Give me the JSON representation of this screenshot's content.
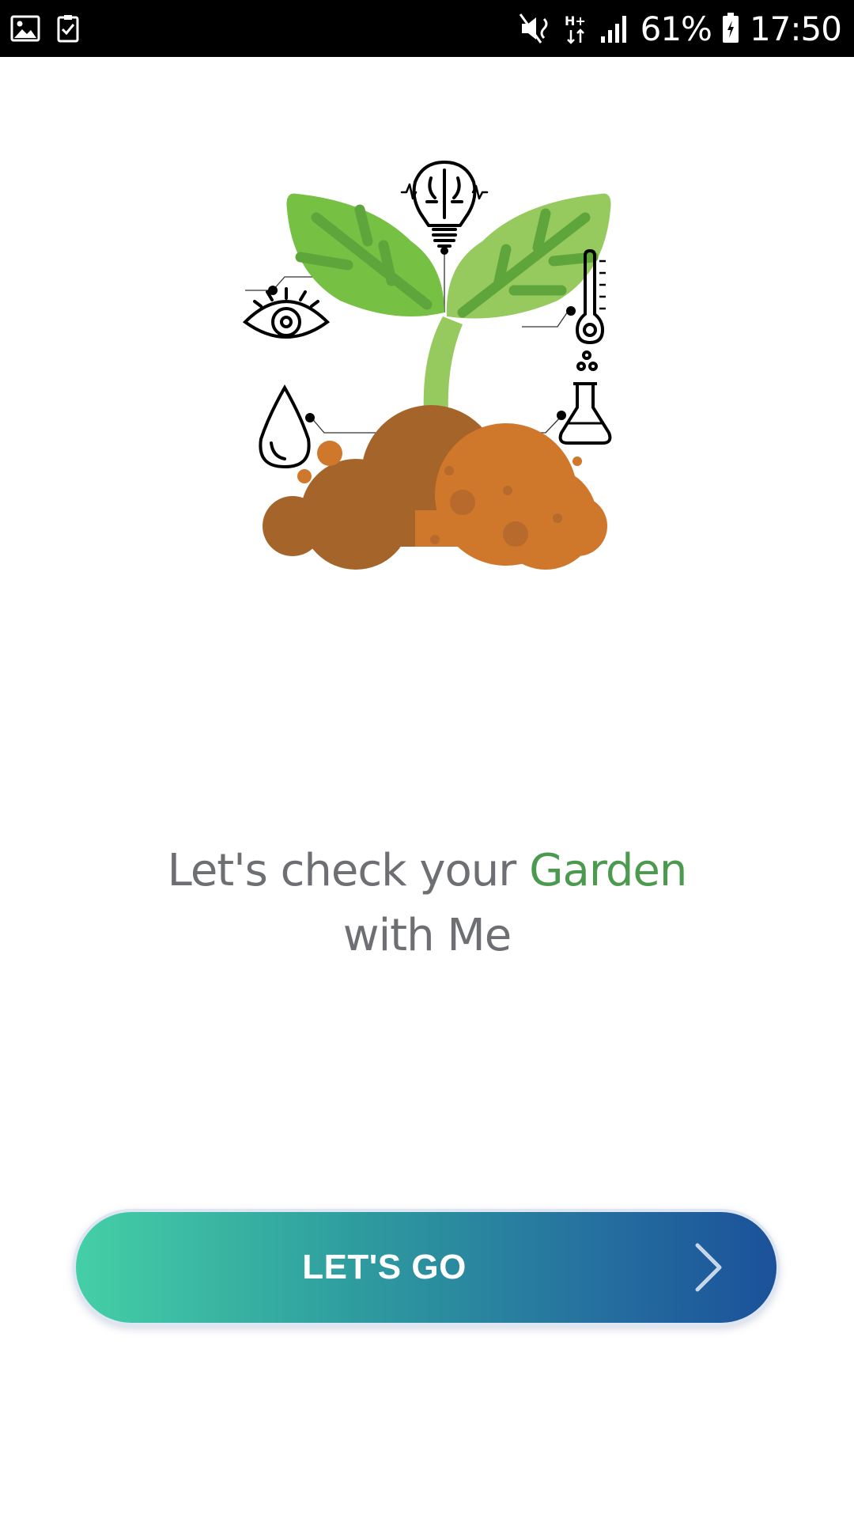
{
  "status_bar": {
    "left_icons": [
      "image-icon",
      "task-check-icon"
    ],
    "right_icons": [
      "mute-vibrate-icon",
      "network-hplus-icon",
      "signal-bars-icon",
      "battery-icon"
    ],
    "network_type": "H+",
    "battery": "61%",
    "time": "17:50"
  },
  "illustration": {
    "icons": [
      "brain-lightbulb-icon",
      "eye-icon",
      "thermometer-icon",
      "flask-icon",
      "water-drop-icon",
      "sprout-icon",
      "soil-icon"
    ]
  },
  "headline": {
    "prefix": "Let's check your",
    "accent": "Garden",
    "suffix": "with Me"
  },
  "cta": {
    "label": "LET'S GO",
    "icon": "chevron-right-icon"
  },
  "colors": {
    "accent_green": "#4c9a4f",
    "gradient_start": "#45cfa6",
    "gradient_end": "#1b519a",
    "text_gray": "#6d6f73"
  }
}
